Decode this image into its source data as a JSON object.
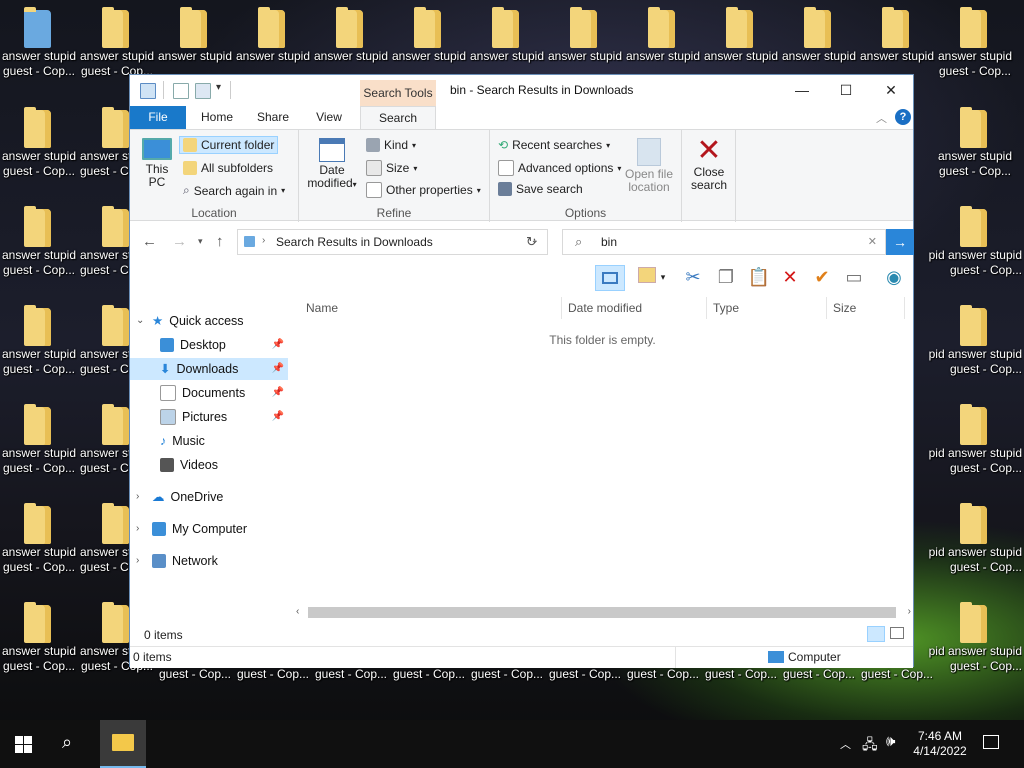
{
  "desktop": {
    "top_row_labels": [
      "answer stupid",
      "answer stupid",
      "answer stupid",
      "answer stupid",
      "answer stupid",
      "answer stupid",
      "answer stupid",
      "answer stupid",
      "answer stupid",
      "answer stupid",
      "answer stupid",
      "answer stupid",
      "answer stupid"
    ],
    "top_row_sublabels": [
      "guest - Cop...",
      "guest - Cop...",
      "",
      "",
      "",
      "",
      "",
      "",
      "",
      "",
      "",
      "",
      "guest - Cop..."
    ],
    "left_col_labels": [
      "answer stupid",
      "answer stupid",
      "answer stupid",
      "answer stupid",
      "answer stupid",
      "answer stupid"
    ],
    "left_col_sublabels": [
      "guest - Cop...",
      "guest - Cop...",
      "guest - Cop...",
      "guest - Cop...",
      "guest - Cop...",
      "guest - Cop..."
    ],
    "second_col_labels": [
      "answer st",
      "answer st",
      "answer st",
      "answer st",
      "answer st",
      "answer st"
    ],
    "second_col_sublabels": [
      "guest - C",
      "guest - C",
      "guest - C",
      "guest - C",
      "guest - C",
      "guest - C"
    ],
    "right_col_labels": [
      "answer stupid",
      "pid answer stupid",
      "pid answer stupid",
      "pid answer stupid",
      "pid answer stupid",
      "pid answer stupid"
    ],
    "right_col_sublabels": [
      "guest - Cop...",
      "guest - Cop...",
      "guest - Cop...",
      "guest - Cop...",
      "guest - Cop...",
      "guest - Cop..."
    ],
    "bottom_sublabels": [
      "guest - Cop...",
      "guest - Cop...",
      "guest - Cop...",
      "guest - Cop...",
      "guest - Cop...",
      "guest - Cop...",
      "guest - Cop...",
      "guest - Cop...",
      "guest - Cop...",
      "guest - Cop...",
      "guest - Cop...",
      "guest - Cop...",
      "guest - Cop..."
    ]
  },
  "window": {
    "title": "bin - Search Results in Downloads",
    "context_tab": "Search Tools",
    "controls": {
      "minimize": "—",
      "maximize": "☐",
      "close": "✕"
    },
    "tabs": {
      "file": "File",
      "home": "Home",
      "share": "Share",
      "view": "View",
      "search": "Search"
    },
    "ribbon": {
      "location": {
        "label": "Location",
        "this_pc": "This PC",
        "current_folder": "Current folder",
        "all_subfolders": "All subfolders",
        "search_again_in": "Search again in"
      },
      "refine": {
        "label": "Refine",
        "date_modified": "Date modified",
        "kind": "Kind",
        "size": "Size",
        "other_properties": "Other properties"
      },
      "options": {
        "label": "Options",
        "recent_searches": "Recent searches",
        "advanced_options": "Advanced options",
        "save_search": "Save search",
        "open_file_location": "Open file location"
      },
      "close_search": "Close search"
    },
    "address": {
      "path": "Search Results in Downloads"
    },
    "search": {
      "value": "bin"
    },
    "nav": {
      "quick_access": "Quick access",
      "items": [
        {
          "label": "Desktop",
          "pinned": true
        },
        {
          "label": "Downloads",
          "pinned": true,
          "selected": true
        },
        {
          "label": "Documents",
          "pinned": true
        },
        {
          "label": "Pictures",
          "pinned": true
        },
        {
          "label": "Music",
          "pinned": false
        },
        {
          "label": "Videos",
          "pinned": false
        }
      ],
      "onedrive": "OneDrive",
      "my_computer": "My Computer",
      "network": "Network"
    },
    "columns": {
      "name": "Name",
      "date_modified": "Date modified",
      "type": "Type",
      "size": "Size"
    },
    "empty_message": "This folder is empty.",
    "status_count": "0 items",
    "statusbar": {
      "items": "0 items",
      "zone": "Computer"
    }
  },
  "taskbar": {
    "time": "7:46 AM",
    "date": "4/14/2022"
  }
}
